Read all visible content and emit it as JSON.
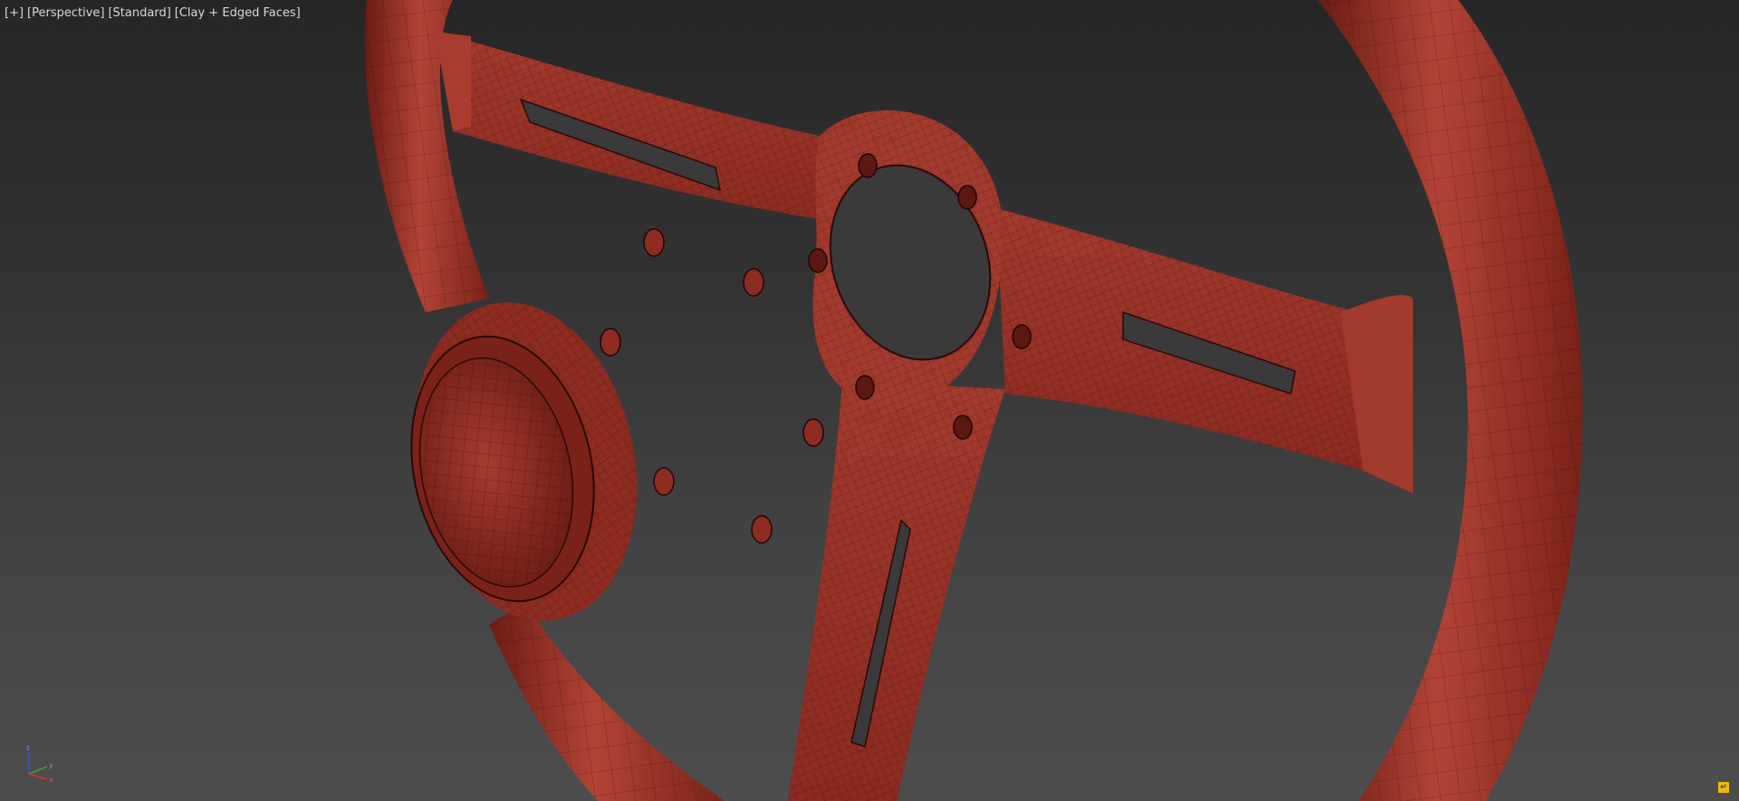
{
  "viewport": {
    "label_plus": "[+]",
    "label_view": "[Perspective]",
    "label_shading_preset": "[Standard]",
    "label_shading_mode": "[Clay + Edged Faces]",
    "background_top": "#262626",
    "background_bottom": "#4d4d4d"
  },
  "model": {
    "object": "steering-wheel",
    "material_color": "#963026",
    "material_highlight": "#b64638",
    "material_shadow": "#5c1812",
    "wire_color": "#2a0806"
  },
  "axis_tripod": {
    "x_label": "x",
    "y_label": "y",
    "z_label": "z",
    "x_color": "#d23a2a",
    "y_color": "#3ca33c",
    "z_color": "#3a56d8"
  },
  "corner_button": {
    "icon": "viewport-config-icon",
    "color": "#e7b814"
  }
}
